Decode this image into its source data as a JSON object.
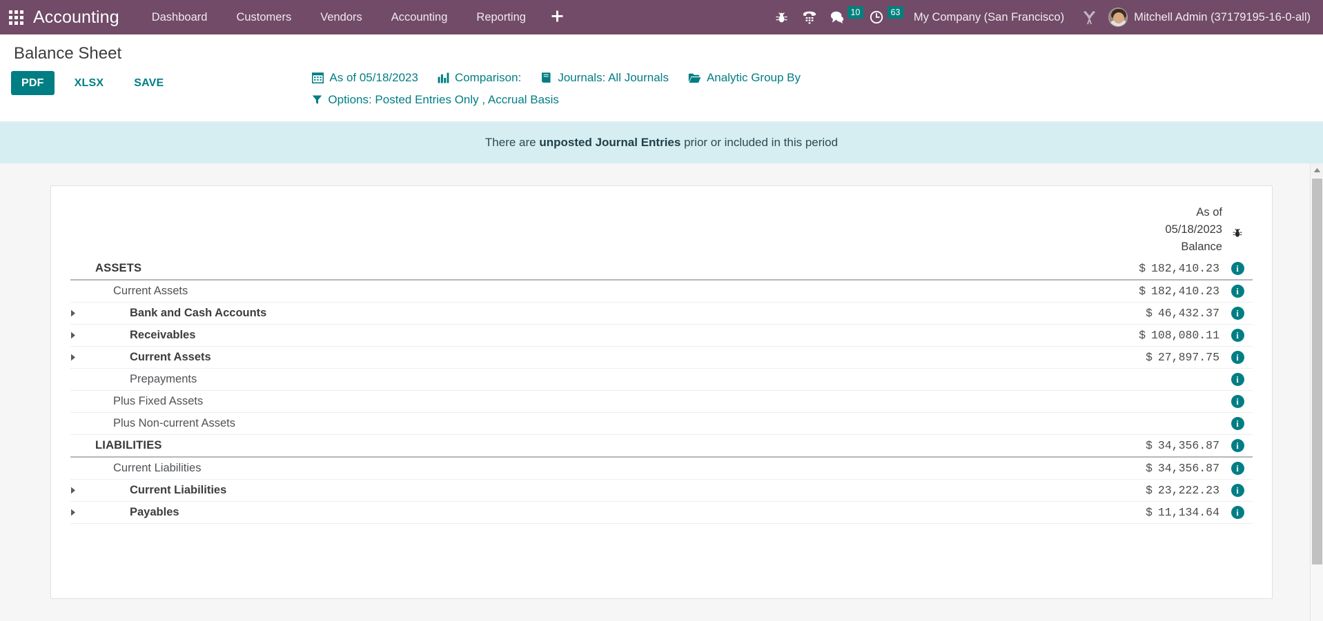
{
  "colors": {
    "navbar": "#714B67",
    "accent_teal": "#017e84",
    "badge_teal": "#00807c",
    "alert_bg": "#d6eef2"
  },
  "navbar": {
    "apps_icon": "apps-grid-icon",
    "brand": "Accounting",
    "menu": [
      {
        "label": "Dashboard"
      },
      {
        "label": "Customers"
      },
      {
        "label": "Vendors"
      },
      {
        "label": "Accounting"
      },
      {
        "label": "Reporting"
      }
    ],
    "plus_label": "+",
    "icons": [
      {
        "name": "bug-icon",
        "badge": null
      },
      {
        "name": "phone-keypad-icon",
        "badge": null
      },
      {
        "name": "messages-icon",
        "badge": "10"
      },
      {
        "name": "activities-clock-icon",
        "badge": "63"
      }
    ],
    "company": "My Company (San Francisco)",
    "wrench_icon": "tools-wrench-icon",
    "user_name": "Mitchell Admin (37179195-16-0-all)"
  },
  "control_panel": {
    "title": "Balance Sheet",
    "buttons": [
      {
        "label": "PDF",
        "style": "primary"
      },
      {
        "label": "XLSX",
        "style": "link"
      },
      {
        "label": "SAVE",
        "style": "link"
      }
    ],
    "filters_row_1": [
      {
        "icon": "calendar-icon",
        "label": "As of 05/18/2023"
      },
      {
        "icon": "bar-chart-icon",
        "label": "Comparison:"
      },
      {
        "icon": "book-icon",
        "label": "Journals: All Journals"
      },
      {
        "icon": "folder-open-icon",
        "label": "Analytic Group By"
      }
    ],
    "filters_row_2": [
      {
        "icon": "filter-funnel-icon",
        "label": "Options: Posted Entries Only , Accrual Basis"
      }
    ]
  },
  "alert": {
    "prefix": "There are ",
    "bold": "unposted Journal Entries",
    "suffix": " prior or included in this period"
  },
  "report": {
    "header": {
      "as_of_line1": "As of",
      "as_of_line2": "05/18/2023",
      "balance": "Balance",
      "bug_icon": "bug-icon"
    },
    "rows": [
      {
        "label": "ASSETS",
        "value": "182,410.23",
        "currency": "$",
        "level": "lvl-0",
        "caret": false,
        "rule": "below",
        "info": true
      },
      {
        "label": "Current Assets",
        "value": "182,410.23",
        "currency": "$",
        "level": "lvl-1",
        "caret": false,
        "rule": "none",
        "info": true
      },
      {
        "label": "Bank and Cash Accounts",
        "value": "46,432.37",
        "currency": "$",
        "level": "lvl-2",
        "caret": true,
        "rule": "none",
        "info": true
      },
      {
        "label": "Receivables",
        "value": "108,080.11",
        "currency": "$",
        "level": "lvl-2",
        "caret": true,
        "rule": "none",
        "info": true
      },
      {
        "label": "Current Assets",
        "value": "27,897.75",
        "currency": "$",
        "level": "lvl-2",
        "caret": true,
        "rule": "none",
        "info": true
      },
      {
        "label": "Prepayments",
        "value": "",
        "currency": "",
        "level": "lvl-2n",
        "caret": false,
        "rule": "none",
        "info": true
      },
      {
        "label": "Plus Fixed Assets",
        "value": "",
        "currency": "",
        "level": "lvl-1b",
        "caret": false,
        "rule": "none",
        "info": true
      },
      {
        "label": "Plus Non-current Assets",
        "value": "",
        "currency": "",
        "level": "lvl-1b",
        "caret": false,
        "rule": "none",
        "info": true
      },
      {
        "label": "LIABILITIES",
        "value": "34,356.87",
        "currency": "$",
        "level": "lvl-0",
        "caret": false,
        "rule": "below",
        "info": true
      },
      {
        "label": "Current Liabilities",
        "value": "34,356.87",
        "currency": "$",
        "level": "lvl-1",
        "caret": false,
        "rule": "none",
        "info": true
      },
      {
        "label": "Current Liabilities",
        "value": "23,222.23",
        "currency": "$",
        "level": "lvl-2",
        "caret": true,
        "rule": "none",
        "info": true
      },
      {
        "label": "Payables",
        "value": "11,134.64",
        "currency": "$",
        "level": "lvl-2",
        "caret": true,
        "rule": "none",
        "info": true
      }
    ]
  },
  "scrollbar": {
    "name": "vertical-scrollbar"
  }
}
